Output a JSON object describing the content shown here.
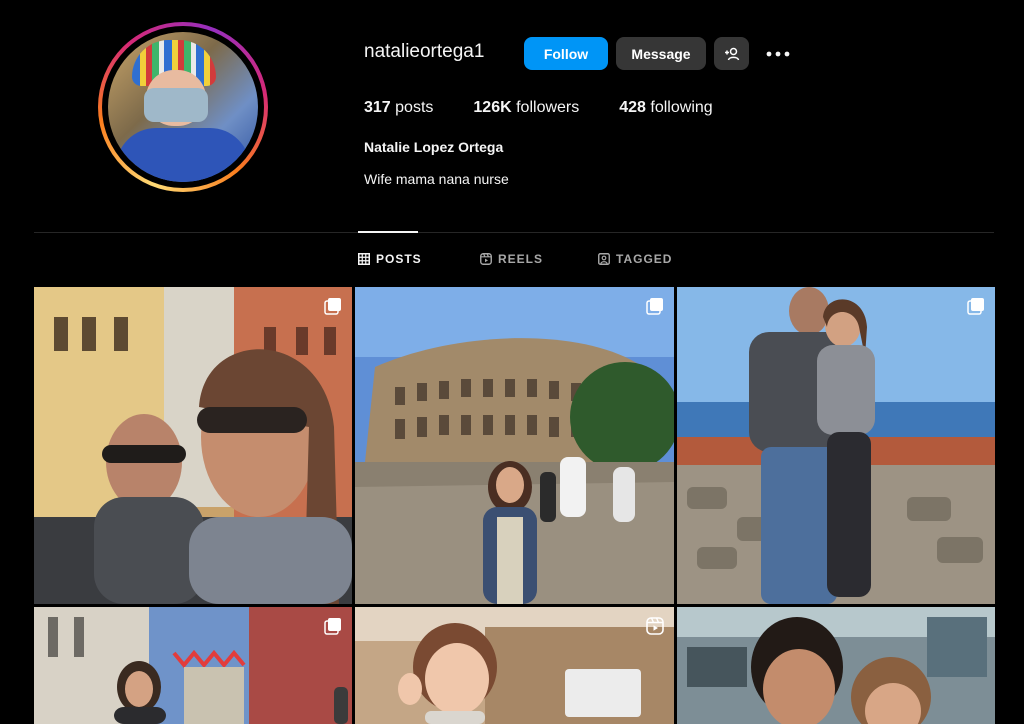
{
  "profile": {
    "username": "natalieortega1",
    "full_name": "Natalie Lopez Ortega",
    "bio": "Wife mama nana nurse"
  },
  "actions": {
    "follow_label": "Follow",
    "message_label": "Message",
    "suggest_icon": "add-person-icon",
    "more_icon": "more-options-icon"
  },
  "stats": {
    "posts_count": "317",
    "posts_label": "posts",
    "followers_count": "126K",
    "followers_label": "followers",
    "following_count": "428",
    "following_label": "following"
  },
  "tabs": [
    {
      "label": "POSTS",
      "icon": "grid-icon",
      "active": true
    },
    {
      "label": "REELS",
      "icon": "reels-icon",
      "active": false
    },
    {
      "label": "TAGGED",
      "icon": "tagged-icon",
      "active": false
    }
  ],
  "posts": [
    {
      "badge": "carousel-icon"
    },
    {
      "badge": "carousel-icon"
    },
    {
      "badge": "carousel-icon"
    },
    {
      "badge": "carousel-icon"
    },
    {
      "badge": "reel-icon"
    },
    {
      "badge": ""
    }
  ],
  "colors": {
    "background": "#000000",
    "accent": "#0095f6",
    "secondary_button": "#363636",
    "muted_text": "#a8a8a8"
  }
}
